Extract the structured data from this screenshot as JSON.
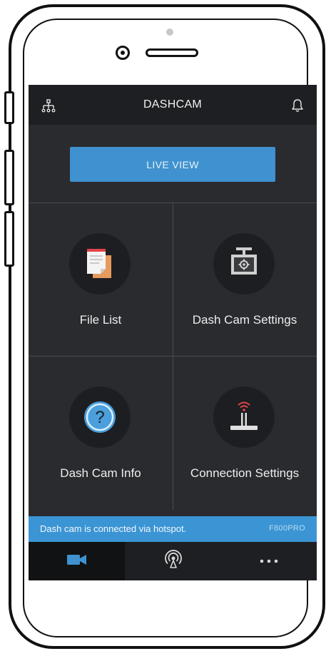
{
  "header": {
    "title": "DASHCAM",
    "left_icon": "network-icon",
    "right_icon": "bell-icon"
  },
  "live_view": {
    "label": "LIVE VIEW"
  },
  "tiles": [
    {
      "label": "File List",
      "icon": "file-list-icon"
    },
    {
      "label": "Dash Cam Settings",
      "icon": "dashcam-settings-icon"
    },
    {
      "label": "Dash Cam Info",
      "icon": "question-icon"
    },
    {
      "label": "Connection Settings",
      "icon": "router-icon"
    }
  ],
  "status_bar": {
    "message": "Dash cam is connected via hotspot.",
    "model": "F800PRO"
  },
  "tab_bar": {
    "tabs": [
      {
        "icon": "video-camera-icon",
        "active": true
      },
      {
        "icon": "broadcast-icon",
        "active": false
      },
      {
        "icon": "more-icon",
        "active": false
      }
    ]
  },
  "colors": {
    "accent": "#3f92cf",
    "status_bar": "#3b95d4",
    "background": "#2a2b2f",
    "bar": "#1e1f22",
    "router_signal": "#e0454a",
    "file_orange": "#e59a5e"
  }
}
